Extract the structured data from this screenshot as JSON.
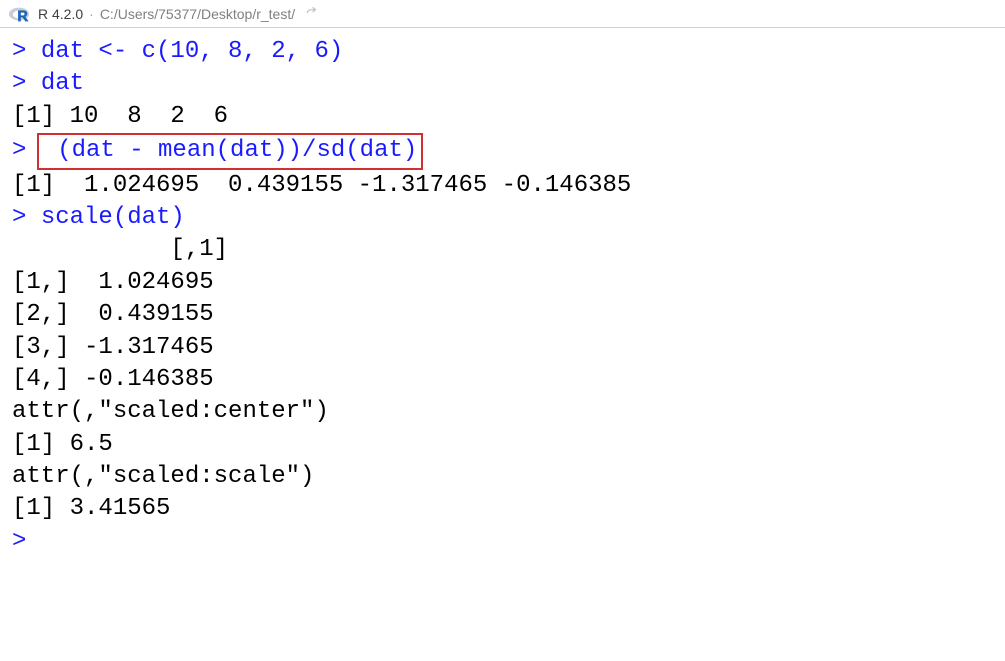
{
  "header": {
    "version": "R 4.2.0",
    "separator": "·",
    "path": "C:/Users/75377/Desktop/r_test/"
  },
  "console": {
    "prompt": ">",
    "lines": [
      {
        "type": "input",
        "text": "dat <- c(10, 8, 2, 6)"
      },
      {
        "type": "input",
        "text": "dat"
      },
      {
        "type": "output",
        "text": "[1] 10  8  2  6"
      },
      {
        "type": "input_highlighted",
        "text": "(dat - mean(dat))/sd(dat)"
      },
      {
        "type": "output",
        "text": "[1]  1.024695  0.439155 -1.317465 -0.146385"
      },
      {
        "type": "input",
        "text": "scale(dat)"
      },
      {
        "type": "output",
        "text": "           [,1]"
      },
      {
        "type": "output",
        "text": "[1,]  1.024695"
      },
      {
        "type": "output",
        "text": "[2,]  0.439155"
      },
      {
        "type": "output",
        "text": "[3,] -1.317465"
      },
      {
        "type": "output",
        "text": "[4,] -0.146385"
      },
      {
        "type": "output",
        "text": "attr(,\"scaled:center\")"
      },
      {
        "type": "output",
        "text": "[1] 6.5"
      },
      {
        "type": "output",
        "text": "attr(,\"scaled:scale\")"
      },
      {
        "type": "output",
        "text": "[1] 3.41565"
      },
      {
        "type": "prompt_only",
        "text": ""
      }
    ]
  }
}
